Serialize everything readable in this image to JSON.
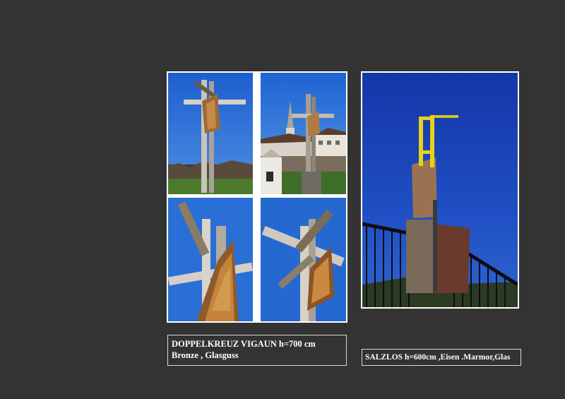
{
  "left_work": {
    "caption_line1": "DOPPELKREUZ VIGAUN  h=700 cm",
    "caption_line2": "Bronze , Glasguss"
  },
  "right_work": {
    "caption": "SALZLOS  h=600cm ,Eisen .Marmor,Glas"
  },
  "colors": {
    "background": "#333333",
    "sky": "#1f5fc8",
    "frame": "#ffffff"
  }
}
